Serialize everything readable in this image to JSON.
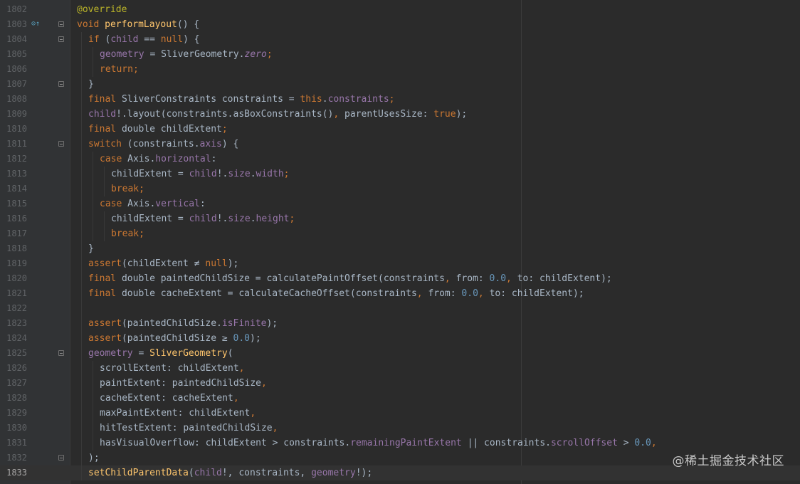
{
  "editor": {
    "lines": [
      {
        "n": "1802",
        "indent": 0,
        "tokens": [
          {
            "t": "@override",
            "c": "ann"
          }
        ]
      },
      {
        "n": "1803",
        "indent": 0,
        "icon": true,
        "fold": true,
        "tokens": [
          {
            "t": "void ",
            "c": "kw"
          },
          {
            "t": "performLayout",
            "c": "fn"
          },
          {
            "t": "() {",
            "c": "plain"
          }
        ]
      },
      {
        "n": "1804",
        "indent": 1,
        "fold": true,
        "tokens": [
          {
            "t": "if ",
            "c": "kw"
          },
          {
            "t": "(",
            "c": "plain"
          },
          {
            "t": "child",
            "c": "prop"
          },
          {
            "t": " == ",
            "c": "plain"
          },
          {
            "t": "null",
            "c": "kw"
          },
          {
            "t": ") {",
            "c": "plain"
          }
        ]
      },
      {
        "n": "1805",
        "indent": 2,
        "tokens": [
          {
            "t": "geometry",
            "c": "prop"
          },
          {
            "t": " = SliverGeometry.",
            "c": "plain"
          },
          {
            "t": "zero",
            "c": "prop it"
          },
          {
            "t": ";",
            "c": "kw"
          }
        ]
      },
      {
        "n": "1806",
        "indent": 2,
        "tokens": [
          {
            "t": "return;",
            "c": "kw"
          }
        ]
      },
      {
        "n": "1807",
        "indent": 1,
        "fold": true,
        "tokens": [
          {
            "t": "}",
            "c": "plain"
          }
        ]
      },
      {
        "n": "1808",
        "indent": 1,
        "tokens": [
          {
            "t": "final ",
            "c": "kw"
          },
          {
            "t": "SliverConstraints constraints = ",
            "c": "plain"
          },
          {
            "t": "this",
            "c": "kw"
          },
          {
            "t": ".",
            "c": "plain"
          },
          {
            "t": "constraints",
            "c": "prop"
          },
          {
            "t": ";",
            "c": "kw"
          }
        ]
      },
      {
        "n": "1809",
        "indent": 1,
        "tokens": [
          {
            "t": "child",
            "c": "prop"
          },
          {
            "t": "!.layout(constraints.asBoxConstraints()",
            "c": "plain"
          },
          {
            "t": ", ",
            "c": "kw"
          },
          {
            "t": "parentUsesSize: ",
            "c": "plain"
          },
          {
            "t": "true",
            "c": "kw"
          },
          {
            "t": ");",
            "c": "plain"
          }
        ]
      },
      {
        "n": "1810",
        "indent": 1,
        "tokens": [
          {
            "t": "final ",
            "c": "kw"
          },
          {
            "t": "double childExtent",
            "c": "plain"
          },
          {
            "t": ";",
            "c": "kw"
          }
        ]
      },
      {
        "n": "1811",
        "indent": 1,
        "fold": true,
        "tokens": [
          {
            "t": "switch ",
            "c": "kw"
          },
          {
            "t": "(constraints.",
            "c": "plain"
          },
          {
            "t": "axis",
            "c": "prop"
          },
          {
            "t": ") {",
            "c": "plain"
          }
        ]
      },
      {
        "n": "1812",
        "indent": 2,
        "tokens": [
          {
            "t": "case ",
            "c": "kw"
          },
          {
            "t": "Axis.",
            "c": "plain"
          },
          {
            "t": "horizontal",
            "c": "prop"
          },
          {
            "t": ":",
            "c": "plain"
          }
        ]
      },
      {
        "n": "1813",
        "indent": 3,
        "tokens": [
          {
            "t": "childExtent = ",
            "c": "plain"
          },
          {
            "t": "child",
            "c": "prop"
          },
          {
            "t": "!.",
            "c": "plain"
          },
          {
            "t": "size",
            "c": "prop"
          },
          {
            "t": ".",
            "c": "plain"
          },
          {
            "t": "width",
            "c": "prop"
          },
          {
            "t": ";",
            "c": "kw"
          }
        ]
      },
      {
        "n": "1814",
        "indent": 3,
        "tokens": [
          {
            "t": "break;",
            "c": "kw"
          }
        ]
      },
      {
        "n": "1815",
        "indent": 2,
        "tokens": [
          {
            "t": "case ",
            "c": "kw"
          },
          {
            "t": "Axis.",
            "c": "plain"
          },
          {
            "t": "vertical",
            "c": "prop"
          },
          {
            "t": ":",
            "c": "plain"
          }
        ]
      },
      {
        "n": "1816",
        "indent": 3,
        "tokens": [
          {
            "t": "childExtent = ",
            "c": "plain"
          },
          {
            "t": "child",
            "c": "prop"
          },
          {
            "t": "!.",
            "c": "plain"
          },
          {
            "t": "size",
            "c": "prop"
          },
          {
            "t": ".",
            "c": "plain"
          },
          {
            "t": "height",
            "c": "prop"
          },
          {
            "t": ";",
            "c": "kw"
          }
        ]
      },
      {
        "n": "1817",
        "indent": 3,
        "tokens": [
          {
            "t": "break;",
            "c": "kw"
          }
        ]
      },
      {
        "n": "1818",
        "indent": 1,
        "tokens": [
          {
            "t": "}",
            "c": "plain"
          }
        ]
      },
      {
        "n": "1819",
        "indent": 1,
        "tokens": [
          {
            "t": "assert",
            "c": "kw"
          },
          {
            "t": "(childExtent ≠ ",
            "c": "plain"
          },
          {
            "t": "null",
            "c": "kw"
          },
          {
            "t": ");",
            "c": "plain"
          }
        ]
      },
      {
        "n": "1820",
        "indent": 1,
        "tokens": [
          {
            "t": "final ",
            "c": "kw"
          },
          {
            "t": "double paintedChildSize = calculatePaintOffset(constraints",
            "c": "plain"
          },
          {
            "t": ", ",
            "c": "kw"
          },
          {
            "t": "from: ",
            "c": "plain"
          },
          {
            "t": "0.0",
            "c": "num"
          },
          {
            "t": ", ",
            "c": "kw"
          },
          {
            "t": "to: childExtent);",
            "c": "plain"
          }
        ]
      },
      {
        "n": "1821",
        "indent": 1,
        "tokens": [
          {
            "t": "final ",
            "c": "kw"
          },
          {
            "t": "double cacheExtent = calculateCacheOffset(constraints",
            "c": "plain"
          },
          {
            "t": ", ",
            "c": "kw"
          },
          {
            "t": "from: ",
            "c": "plain"
          },
          {
            "t": "0.0",
            "c": "num"
          },
          {
            "t": ", ",
            "c": "kw"
          },
          {
            "t": "to: childExtent);",
            "c": "plain"
          }
        ]
      },
      {
        "n": "1822",
        "indent": 0,
        "tokens": []
      },
      {
        "n": "1823",
        "indent": 1,
        "tokens": [
          {
            "t": "assert",
            "c": "kw"
          },
          {
            "t": "(paintedChildSize.",
            "c": "plain"
          },
          {
            "t": "isFinite",
            "c": "prop"
          },
          {
            "t": ");",
            "c": "plain"
          }
        ]
      },
      {
        "n": "1824",
        "indent": 1,
        "tokens": [
          {
            "t": "assert",
            "c": "kw"
          },
          {
            "t": "(paintedChildSize ≥ ",
            "c": "plain"
          },
          {
            "t": "0.0",
            "c": "num"
          },
          {
            "t": ");",
            "c": "plain"
          }
        ]
      },
      {
        "n": "1825",
        "indent": 1,
        "fold": true,
        "tokens": [
          {
            "t": "geometry",
            "c": "prop"
          },
          {
            "t": " = ",
            "c": "plain"
          },
          {
            "t": "SliverGeometry",
            "c": "fn"
          },
          {
            "t": "(",
            "c": "plain"
          }
        ]
      },
      {
        "n": "1826",
        "indent": 2,
        "tokens": [
          {
            "t": "scrollExtent: childExtent",
            "c": "plain"
          },
          {
            "t": ",",
            "c": "kw"
          }
        ]
      },
      {
        "n": "1827",
        "indent": 2,
        "tokens": [
          {
            "t": "paintExtent: paintedChildSize",
            "c": "plain"
          },
          {
            "t": ",",
            "c": "kw"
          }
        ]
      },
      {
        "n": "1828",
        "indent": 2,
        "tokens": [
          {
            "t": "cacheExtent: cacheExtent",
            "c": "plain"
          },
          {
            "t": ",",
            "c": "kw"
          }
        ]
      },
      {
        "n": "1829",
        "indent": 2,
        "tokens": [
          {
            "t": "maxPaintExtent: childExtent",
            "c": "plain"
          },
          {
            "t": ",",
            "c": "kw"
          }
        ]
      },
      {
        "n": "1830",
        "indent": 2,
        "tokens": [
          {
            "t": "hitTestExtent: paintedChildSize",
            "c": "plain"
          },
          {
            "t": ",",
            "c": "kw"
          }
        ]
      },
      {
        "n": "1831",
        "indent": 2,
        "tokens": [
          {
            "t": "hasVisualOverflow: childExtent > constraints.",
            "c": "plain"
          },
          {
            "t": "remainingPaintExtent",
            "c": "prop"
          },
          {
            "t": " || constraints.",
            "c": "plain"
          },
          {
            "t": "scrollOffset",
            "c": "prop"
          },
          {
            "t": " > ",
            "c": "plain"
          },
          {
            "t": "0.0",
            "c": "num"
          },
          {
            "t": ",",
            "c": "kw"
          }
        ]
      },
      {
        "n": "1832",
        "indent": 1,
        "fold": true,
        "tokens": [
          {
            "t": ");",
            "c": "plain"
          }
        ]
      },
      {
        "n": "1833",
        "indent": 1,
        "current": true,
        "tokens": [
          {
            "t": "setChildParentData",
            "c": "fn"
          },
          {
            "t": "(",
            "c": "plain"
          },
          {
            "t": "child",
            "c": "prop"
          },
          {
            "t": "!, constraints, ",
            "c": "plain"
          },
          {
            "t": "geometry",
            "c": "prop"
          },
          {
            "t": "!);",
            "c": "plain"
          }
        ]
      }
    ]
  },
  "watermark": "@稀土掘金技术社区",
  "icons": {
    "override_marker": "override-gutter-icon",
    "fold": "fold-marker-icon"
  }
}
